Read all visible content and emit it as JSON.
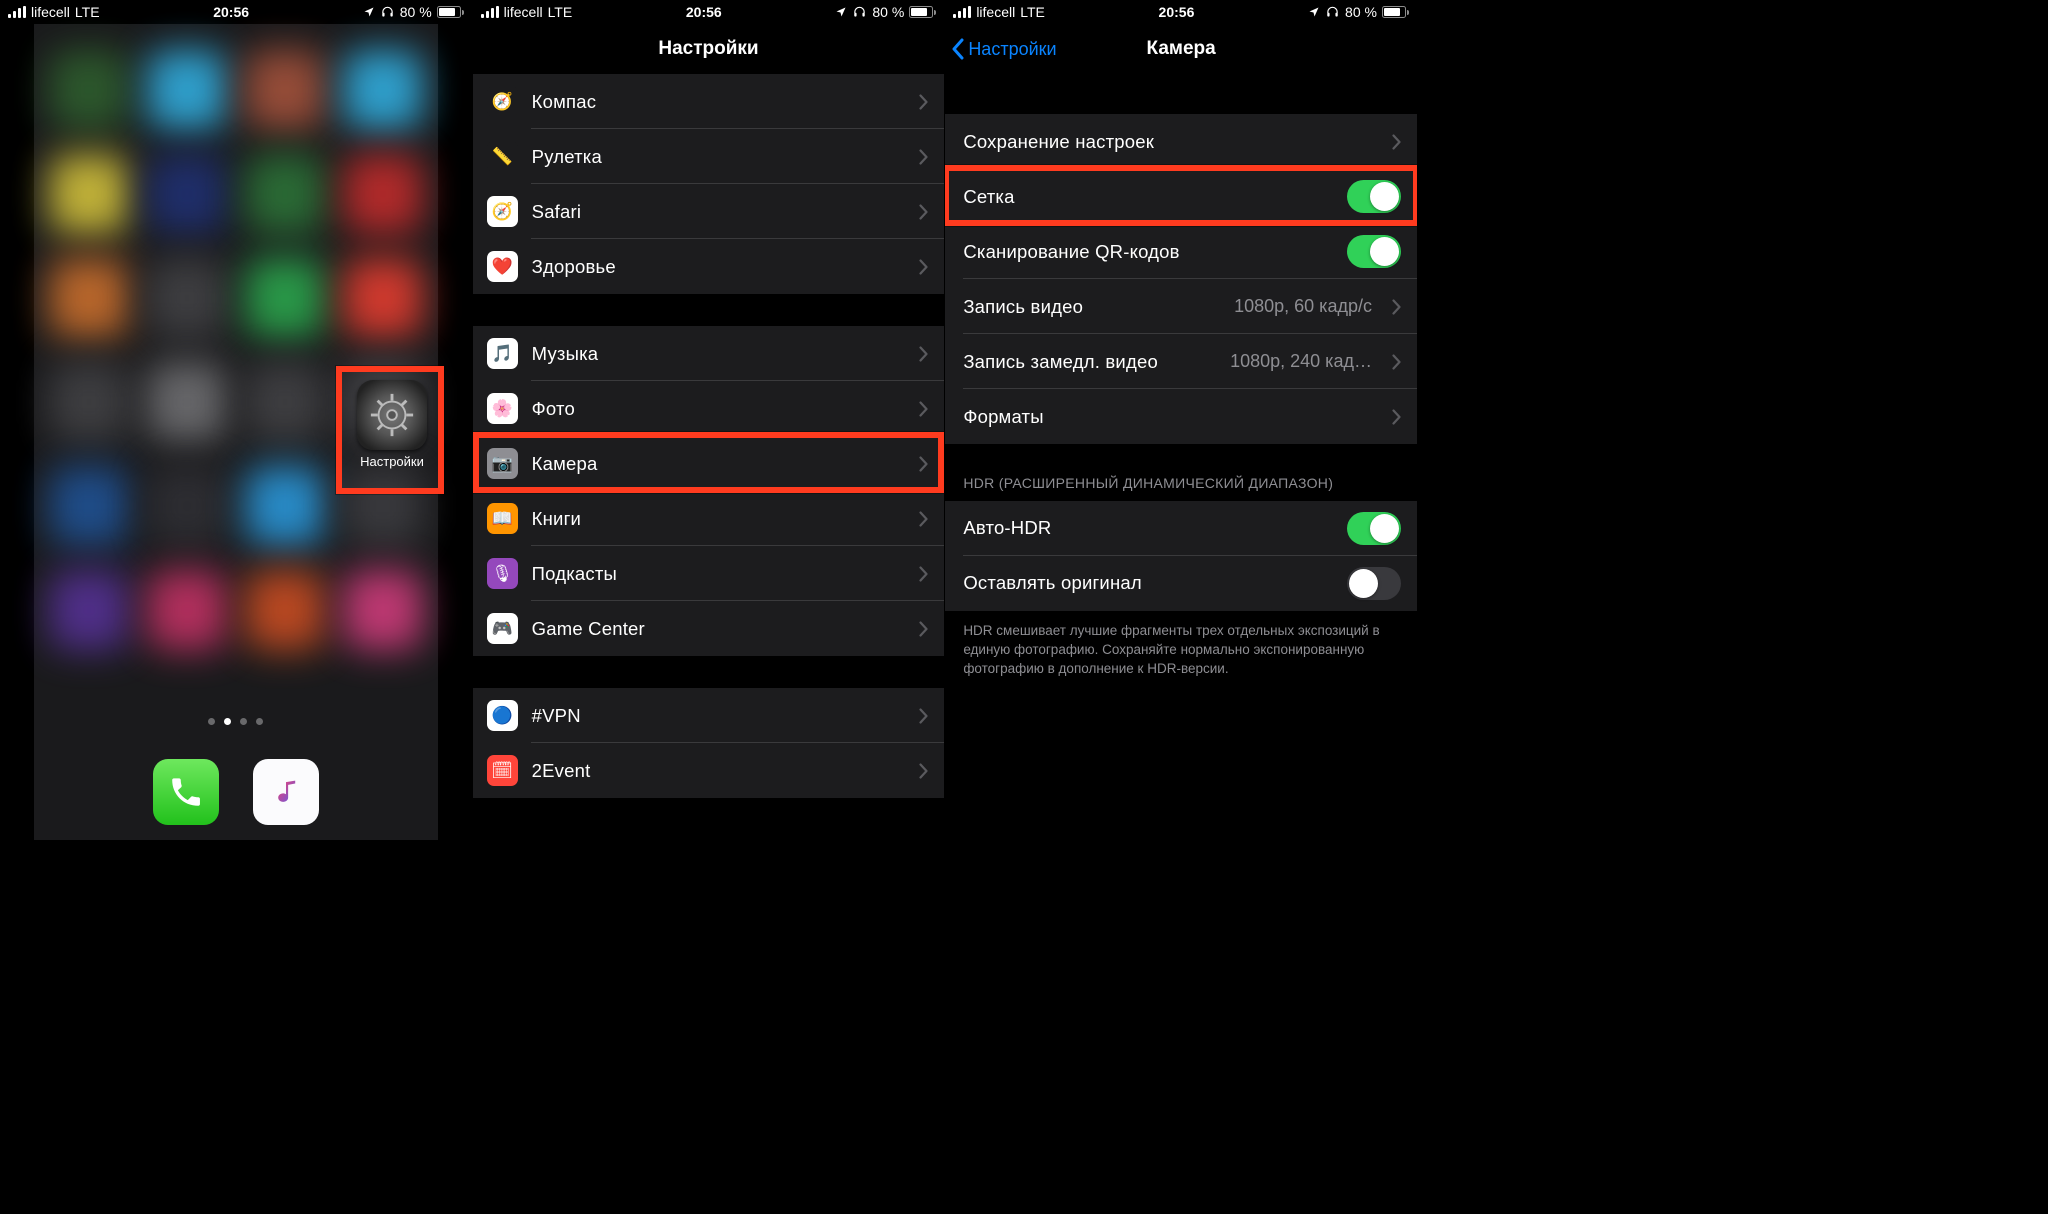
{
  "status": {
    "carrier": "lifecell",
    "network": "LTE",
    "time": "20:56",
    "battery_pct": "80 %",
    "battery_fill_pct": 80
  },
  "screen1": {
    "settings_label": "Настройки",
    "blur_colors": [
      "#2d5a2d",
      "#30a5d4",
      "#9c4f3a",
      "#30a5d4",
      "#c8b83a",
      "#1f2f6e",
      "#2b6e36",
      "#b82b2b",
      "#c06a2c",
      "#3f3f42",
      "#2a9e4a",
      "#d83b2f",
      "#3f3f42",
      "#6a6a6d",
      "#3f3f42",
      "#46464a",
      "#1f4f8e",
      "#2e2e33",
      "#2990cf",
      "#3a3a3e",
      "#52308e",
      "#b83060",
      "#c04a22",
      "#c53a76"
    ]
  },
  "screen2": {
    "title": "Настройки",
    "groups": [
      {
        "items": [
          {
            "id": "compass",
            "label": "Компас",
            "icon_bg": "#1c1c1e",
            "icon_glyph": "🧭"
          },
          {
            "id": "measure",
            "label": "Рулетка",
            "icon_bg": "#1c1c1e",
            "icon_glyph": "📏"
          },
          {
            "id": "safari",
            "label": "Safari",
            "icon_bg": "#ffffff",
            "icon_glyph": "🧭"
          },
          {
            "id": "health",
            "label": "Здоровье",
            "icon_bg": "#ffffff",
            "icon_glyph": "❤️"
          }
        ]
      },
      {
        "items": [
          {
            "id": "music",
            "label": "Музыка",
            "icon_bg": "#ffffff",
            "icon_glyph": "🎵"
          },
          {
            "id": "photos",
            "label": "Фото",
            "icon_bg": "#ffffff",
            "icon_glyph": "🌸"
          },
          {
            "id": "camera",
            "label": "Камера",
            "icon_bg": "#8e8e93",
            "icon_glyph": "📷",
            "highlight": true
          },
          {
            "id": "books",
            "label": "Книги",
            "icon_bg": "#ff9500",
            "icon_glyph": "📖"
          },
          {
            "id": "podcasts",
            "label": "Подкасты",
            "icon_bg": "#9448bc",
            "icon_glyph": "🎙"
          },
          {
            "id": "gamecenter",
            "label": "Game Center",
            "icon_bg": "#ffffff",
            "icon_glyph": "🎮"
          }
        ]
      },
      {
        "items": [
          {
            "id": "vpn",
            "label": "#VPN",
            "icon_bg": "#ffffff",
            "icon_glyph": "🔵"
          },
          {
            "id": "2event",
            "label": "2Event",
            "icon_bg": "#ff453a",
            "icon_glyph": "🗓"
          }
        ]
      }
    ]
  },
  "screen3": {
    "back": "Настройки",
    "title": "Камера",
    "group1": [
      {
        "id": "preserve",
        "label": "Сохранение настроек",
        "type": "link"
      },
      {
        "id": "grid",
        "label": "Сетка",
        "type": "toggle",
        "on": true,
        "highlight": true
      },
      {
        "id": "qr",
        "label": "Сканирование QR-кодов",
        "type": "toggle",
        "on": true
      },
      {
        "id": "video",
        "label": "Запись видео",
        "type": "link",
        "value": "1080p, 60 кадр/с"
      },
      {
        "id": "slomo",
        "label": "Запись замедл. видео",
        "type": "link",
        "value": "1080p, 240 кад…"
      },
      {
        "id": "formats",
        "label": "Форматы",
        "type": "link"
      }
    ],
    "hdr_header": "HDR (РАСШИРЕННЫЙ ДИНАМИЧЕСКИЙ ДИАПАЗОН)",
    "group2": [
      {
        "id": "autohdr",
        "label": "Авто-HDR",
        "type": "toggle",
        "on": true
      },
      {
        "id": "keepnormal",
        "label": "Оставлять оригинал",
        "type": "toggle",
        "on": false
      }
    ],
    "hdr_footer": "HDR смешивает лучшие фрагменты трех отдельных экспозиций в единую фотографию. Сохраняйте нормально экспонированную фотографию в дополнение к HDR-версии."
  }
}
